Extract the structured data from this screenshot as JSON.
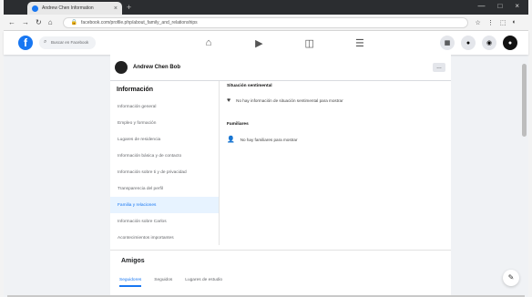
{
  "browser": {
    "tab_title": "Andrew Chen Information",
    "tab_close": "×",
    "new_tab": "+",
    "window_buttons": [
      "—",
      "□",
      "×"
    ],
    "nav": {
      "back": "←",
      "forward": "→",
      "reload": "↻",
      "home": "⌂"
    },
    "url": "facebook.com/profile.php/about_family_and_relationships",
    "lock": "🔒",
    "addr_icons": [
      "☆",
      "⋮",
      "⬚",
      "◐"
    ]
  },
  "facebook": {
    "logo": "f",
    "search_placeholder": "Buscar en Facebook",
    "search_icon": "⌕",
    "nav_icons": [
      "⌂",
      "▶",
      "◫",
      "☰"
    ],
    "right_icons": [
      "▦",
      "●",
      "◉",
      "●"
    ]
  },
  "profile": {
    "name": "Andrew Chen Bob",
    "menu": "…"
  },
  "about": {
    "title": "Información",
    "items": [
      "Información general",
      "Empleo y formación",
      "Lugares de residencia",
      "Información básica y de contacto",
      "Información sobre ti y de privacidad",
      "Transparencia del perfil",
      "Familia y relaciones",
      "Información sobre Carlos",
      "Acontecimientos importantes"
    ],
    "active_index": 6
  },
  "right": {
    "section1_title": "Situación sentimental",
    "section1_text": "No hay información de situación sentimental para mostrar",
    "section1_icon": "♥",
    "section2_title": "Familiares",
    "section2_text": "No hay familiares para mostrar",
    "section2_icon": "👤"
  },
  "friends": {
    "title": "Amigos",
    "tabs": [
      "Seguidores",
      "Seguidos",
      "Lugares de estudio"
    ]
  },
  "widgets": {
    "message_button": "✎"
  }
}
